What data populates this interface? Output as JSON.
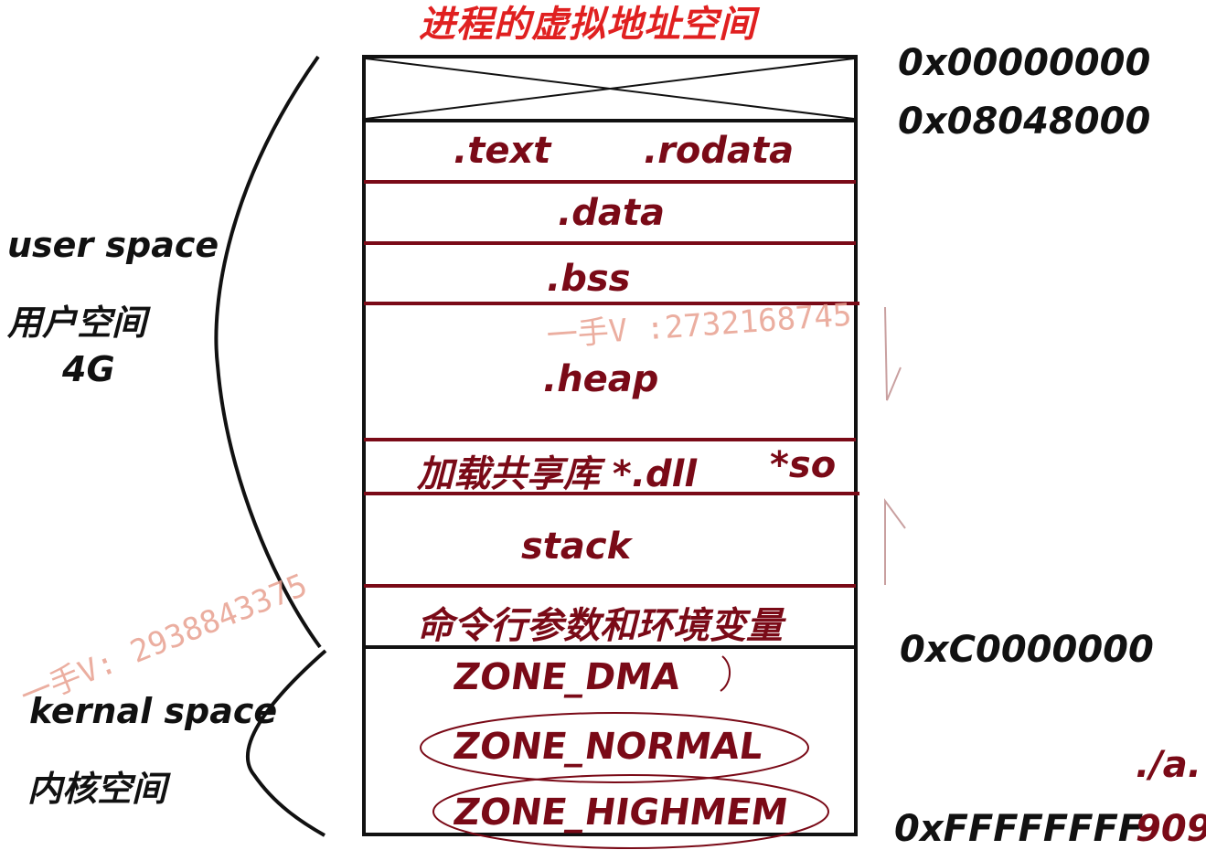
{
  "title": "进程的虚拟地址空间",
  "addresses": {
    "start": "0x00000000",
    "text_start": "0x08048000",
    "kernel_start": "0xC0000000",
    "end": "0xFFFFFFFF"
  },
  "end_suffix": "909",
  "run_command": "./a.",
  "segments": {
    "text": ".text",
    "rodata": ".rodata",
    "data": ".data",
    "bss": ".bss",
    "heap": ".heap",
    "shared_libs": "加载共享库 *.dll",
    "so": "*so",
    "stack": "stack",
    "args_env": "命令行参数和环境变量"
  },
  "kernel_zones": {
    "dma": "ZONE_DMA",
    "normal": "ZONE_NORMAL",
    "highmem": "ZONE_HIGHMEM"
  },
  "labels": {
    "user_space": "user space",
    "user_space_cn": "用户空间",
    "user_size": "4G",
    "kernel_space": "kernal space",
    "kernel_space_cn": "内核空间"
  },
  "watermarks": {
    "top": "一手V :2732168745",
    "bottom": "一手V: 2938843375"
  },
  "colors": {
    "title": "#e02020",
    "segment": "#7a0a17",
    "box": "#111111",
    "watermark": "#e8a090"
  }
}
